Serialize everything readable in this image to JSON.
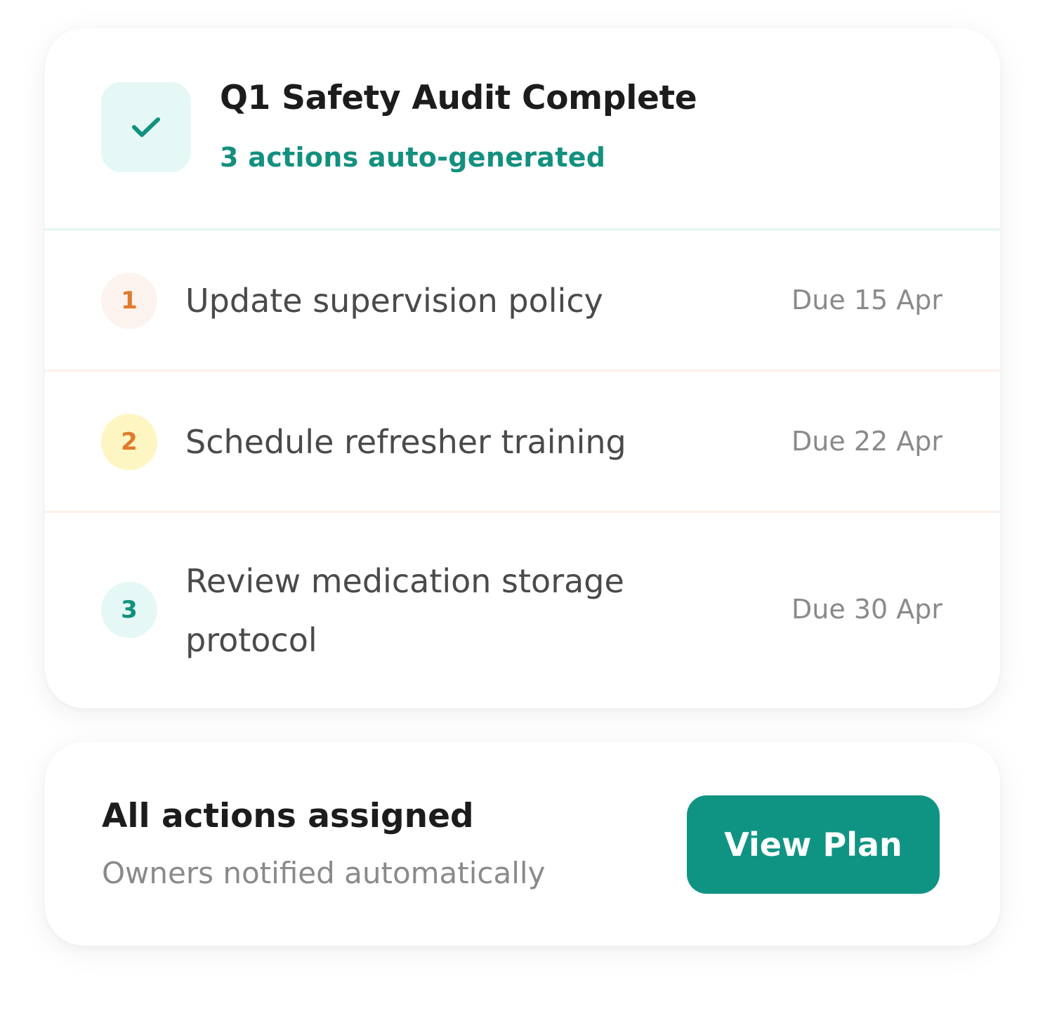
{
  "header": {
    "icon": "check-icon",
    "title": "Q1 Safety Audit Complete",
    "subtitle": "3 actions auto-generated"
  },
  "actions": [
    {
      "number": "1",
      "label": "Update supervision policy",
      "due": "Due 15 Apr",
      "badge_bg": "#fdf3ee",
      "badge_color": "#e07b2c"
    },
    {
      "number": "2",
      "label": "Schedule refresher training",
      "due": "Due 22 Apr",
      "badge_bg": "#fef6c2",
      "badge_color": "#e07b2c"
    },
    {
      "number": "3",
      "label_line1": "Review medication storage",
      "label_line2": "protocol",
      "due": "Due 30 Apr",
      "badge_bg": "#e5f8f5",
      "badge_color": "#13907f"
    }
  ],
  "footer": {
    "title": "All actions assigned",
    "subtitle": "Owners notified automatically",
    "button_label": "View Plan"
  },
  "colors": {
    "accent": "#0f9483",
    "accent_text": "#13907f"
  }
}
